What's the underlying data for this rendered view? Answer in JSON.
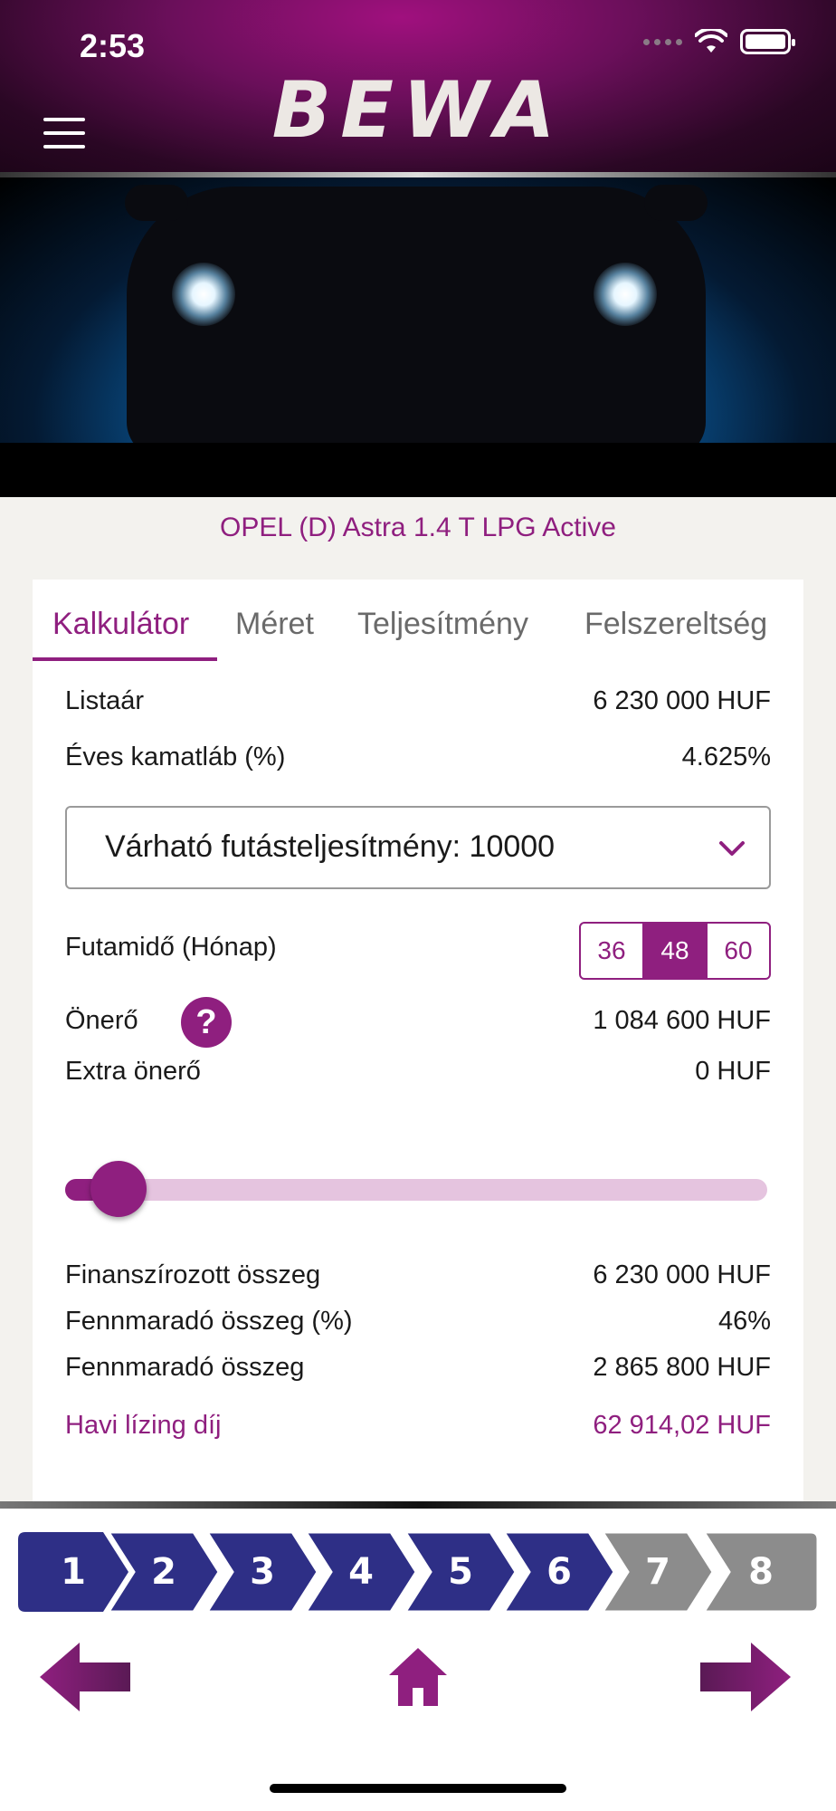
{
  "status_bar": {
    "time": "2:53"
  },
  "header": {
    "logo": "BEWA"
  },
  "car": {
    "name": "OPEL (D) Astra 1.4 T LPG Active"
  },
  "tabs": [
    {
      "label": "Kalkulátor",
      "active": true
    },
    {
      "label": "Méret",
      "active": false
    },
    {
      "label": "Teljesítmény",
      "active": false
    },
    {
      "label": "Felszereltség",
      "active": false
    }
  ],
  "calculator": {
    "list_price_label": "Listaár",
    "list_price_value": "6 230 000 HUF",
    "interest_label": "Éves kamatláb (%)",
    "interest_value": "4.625%",
    "mileage_select": "Várható futásteljesítmény: 10000",
    "term_label": "Futamidő (Hónap)",
    "term_options": [
      "36",
      "48",
      "60"
    ],
    "term_selected": "48",
    "down_payment_label": "Önerő",
    "help_symbol": "?",
    "down_payment_value": "1 084 600 HUF",
    "extra_down_label": "Extra önerő",
    "extra_down_value": "0 HUF",
    "extra_down_slider_fraction": 0.0,
    "financed_label": "Finanszírozott összeg",
    "financed_value": "6 230 000 HUF",
    "residual_pct_label": "Fennmaradó összeg (%)",
    "residual_pct_value": "46%",
    "residual_label": "Fennmaradó összeg",
    "residual_value": "2 865 800 HUF",
    "monthly_label": "Havi lízing díj",
    "monthly_value": "62 914,02 HUF"
  },
  "steps": [
    {
      "label": "1",
      "state": "done"
    },
    {
      "label": "2",
      "state": "done"
    },
    {
      "label": "3",
      "state": "done"
    },
    {
      "label": "4",
      "state": "done"
    },
    {
      "label": "5",
      "state": "done"
    },
    {
      "label": "6",
      "state": "current"
    },
    {
      "label": "7",
      "state": "pending"
    },
    {
      "label": "8",
      "state": "pending"
    }
  ],
  "colors": {
    "accent": "#8f1f7f",
    "step_active": "#2e2f86",
    "step_inactive": "#8c8c8c"
  },
  "icons": {
    "menu": "hamburger-icon",
    "dropdown": "chevron-down-icon",
    "help": "question-icon",
    "back": "arrow-left-icon",
    "home": "home-icon",
    "next": "arrow-right-icon"
  }
}
